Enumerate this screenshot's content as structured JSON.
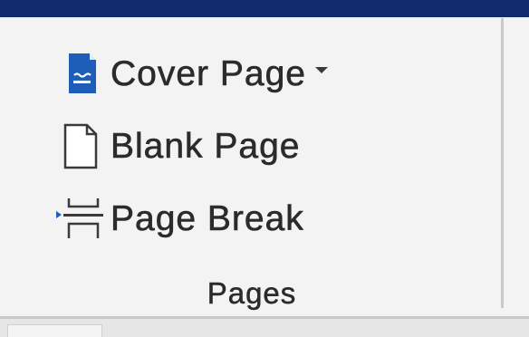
{
  "ribbon": {
    "group": {
      "label": "Pages",
      "commands": [
        {
          "label": "Cover Page",
          "icon": "cover-page-icon",
          "has_dropdown": true
        },
        {
          "label": "Blank Page",
          "icon": "blank-page-icon"
        },
        {
          "label": "Page Break",
          "icon": "page-break-icon"
        }
      ]
    }
  },
  "colors": {
    "title_bar": "#102a6b",
    "icon_blue": "#1e5db8",
    "background": "#f3f3f3"
  }
}
